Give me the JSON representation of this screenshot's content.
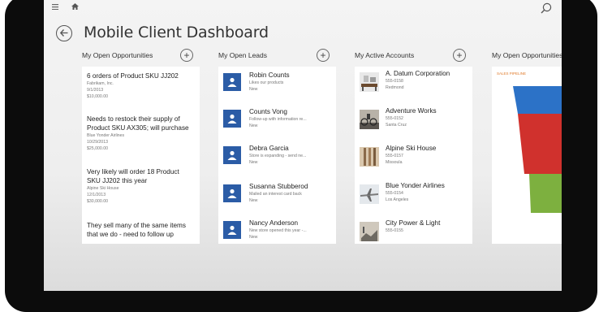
{
  "page": {
    "title": "Mobile Client Dashboard"
  },
  "icons": {
    "menu": "menu-icon",
    "home": "home-icon",
    "search": "search-icon",
    "back": "back-arrow-icon",
    "add": "add-circle-icon",
    "lead": "lead-person-icon"
  },
  "columns": {
    "opportunities": {
      "header": "My Open Opportunities",
      "items": [
        {
          "title": "6 orders of Product SKU JJ202",
          "sub": [
            "Fabrikam, Inc.",
            "9/1/2013",
            "$10,000.00"
          ]
        },
        {
          "title": "Needs to restock their supply of Product SKU AX305; will purchase",
          "sub": [
            "Blue Yonder Airlines",
            "10/29/2013",
            "$25,000.00"
          ]
        },
        {
          "title": "Very likely will order 18 Product SKU JJ202 this year",
          "sub": [
            "Alpine Ski House",
            "12/1/2013",
            "$30,000.00"
          ]
        },
        {
          "title": "They sell many of the same items that we do - need to follow up",
          "sub": []
        }
      ]
    },
    "leads": {
      "header": "My Open Leads",
      "items": [
        {
          "name": "Robin Counts",
          "desc": "Likes our products",
          "status": "New"
        },
        {
          "name": "Counts Vong",
          "desc": "Follow-up with information re...",
          "status": "New"
        },
        {
          "name": "Debra Garcia",
          "desc": "Store is expanding - send ne...",
          "status": "New"
        },
        {
          "name": "Susanna Stubberod",
          "desc": "Mailed an interest card back",
          "status": "New"
        },
        {
          "name": "Nancy Anderson",
          "desc": "New store opened this year -...",
          "status": "New"
        }
      ]
    },
    "accounts": {
      "header": "My Active Accounts",
      "items": [
        {
          "name": "A. Datum Corporation",
          "phone": "555-0158",
          "city": "Redmond"
        },
        {
          "name": "Adventure Works",
          "phone": "555-0152",
          "city": "Santa Cruz"
        },
        {
          "name": "Alpine Ski House",
          "phone": "555-0157",
          "city": "Missoula"
        },
        {
          "name": "Blue Yonder Airlines",
          "phone": "555-0154",
          "city": "Los Angeles"
        },
        {
          "name": "City Power & Light",
          "phone": "555-0155",
          "city": ""
        }
      ]
    },
    "pipeline": {
      "header": "My Open Opportunities",
      "chart_label": "SALES PIPELINE"
    }
  },
  "chart_data": {
    "type": "funnel",
    "title": "SALES PIPELINE",
    "series": [
      {
        "color": "#2c72c7"
      },
      {
        "color": "#d0312d"
      },
      {
        "color": "#7db03f"
      }
    ]
  }
}
